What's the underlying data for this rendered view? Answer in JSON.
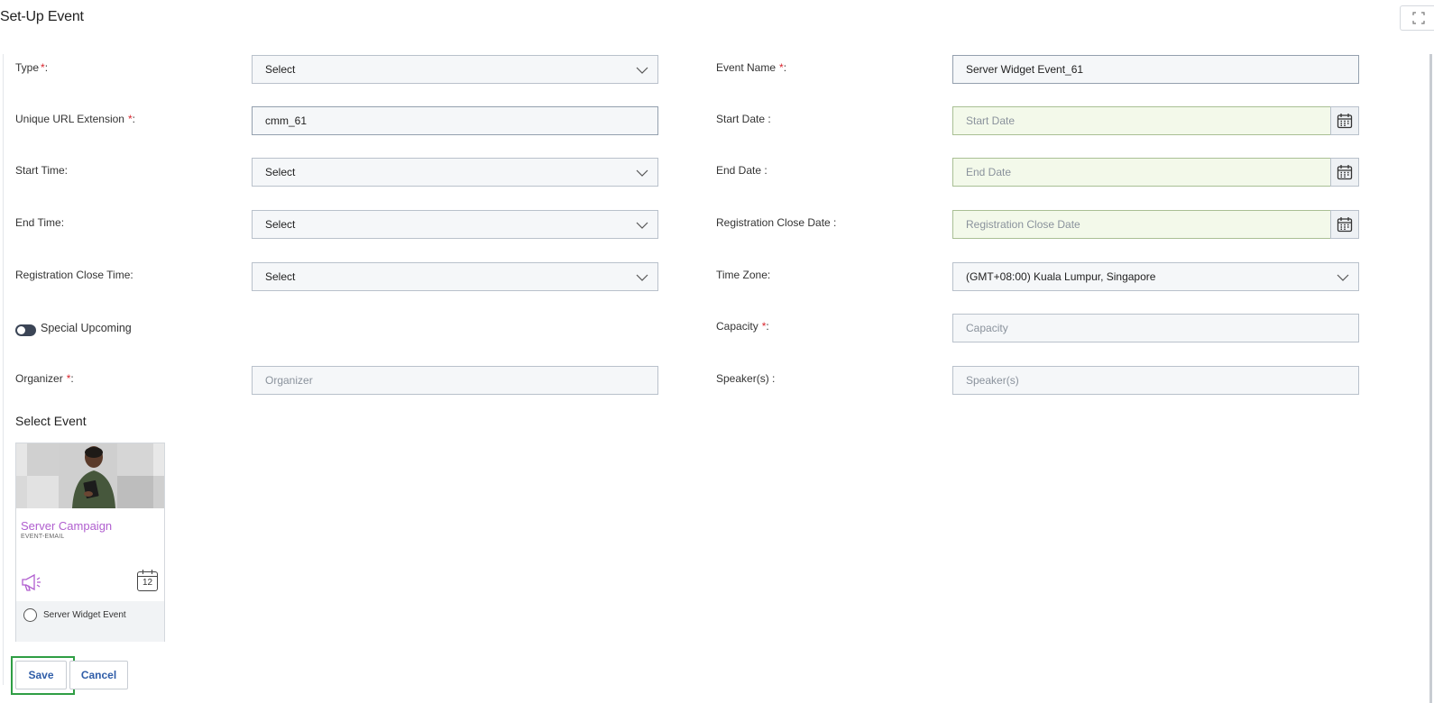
{
  "header": {
    "title": "Set-Up Event"
  },
  "form": {
    "type": {
      "label": "Type",
      "required": "*",
      "value": "Select"
    },
    "event_name": {
      "label": "Event Name",
      "required": "*",
      "value": "Server Widget Event_61"
    },
    "url_extension": {
      "label": "Unique URL Extension",
      "required": "*",
      "value": "cmm_61"
    },
    "start_date": {
      "label": "Start Date :",
      "placeholder": "Start Date"
    },
    "start_time": {
      "label": "Start Time:",
      "value": "Select"
    },
    "end_date": {
      "label": "End Date :",
      "placeholder": "End Date"
    },
    "end_time": {
      "label": "End Time:",
      "value": "Select"
    },
    "reg_close_date": {
      "label": "Registration Close Date :",
      "placeholder": "Registration Close Date"
    },
    "reg_close_time": {
      "label": "Registration Close Time:",
      "value": "Select"
    },
    "time_zone": {
      "label": "Time Zone:",
      "value": "(GMT+08:00) Kuala Lumpur, Singapore"
    },
    "special_upcoming": {
      "label": "Special Upcoming",
      "enabled": false
    },
    "capacity": {
      "label": "Capacity",
      "required": "*",
      "placeholder": "Capacity"
    },
    "organizer": {
      "label": "Organizer",
      "required": "*",
      "placeholder": "Organizer"
    },
    "speakers": {
      "label": "Speaker(s) :",
      "placeholder": "Speaker(s)"
    }
  },
  "select_event": {
    "title": "Select Event",
    "cards": [
      {
        "title": "Server Campaign",
        "subtitle": "EVENT-EMAIL",
        "calendar_day": "12",
        "option_label": "Server Widget Event",
        "selected": false
      }
    ]
  },
  "actions": {
    "save_label": "Save",
    "cancel_label": "Cancel"
  },
  "icons": {
    "dropdown": "chevron-down-icon",
    "date": "calendar-icon",
    "expand": "expand-icon",
    "campaign": "megaphone-icon"
  },
  "colors": {
    "accent": "#2f5da8",
    "required": "#d9262e",
    "campaign_title": "#b05ecf",
    "date_field_bg": "#f3f9ea",
    "focus_outline": "#2f9e44"
  }
}
